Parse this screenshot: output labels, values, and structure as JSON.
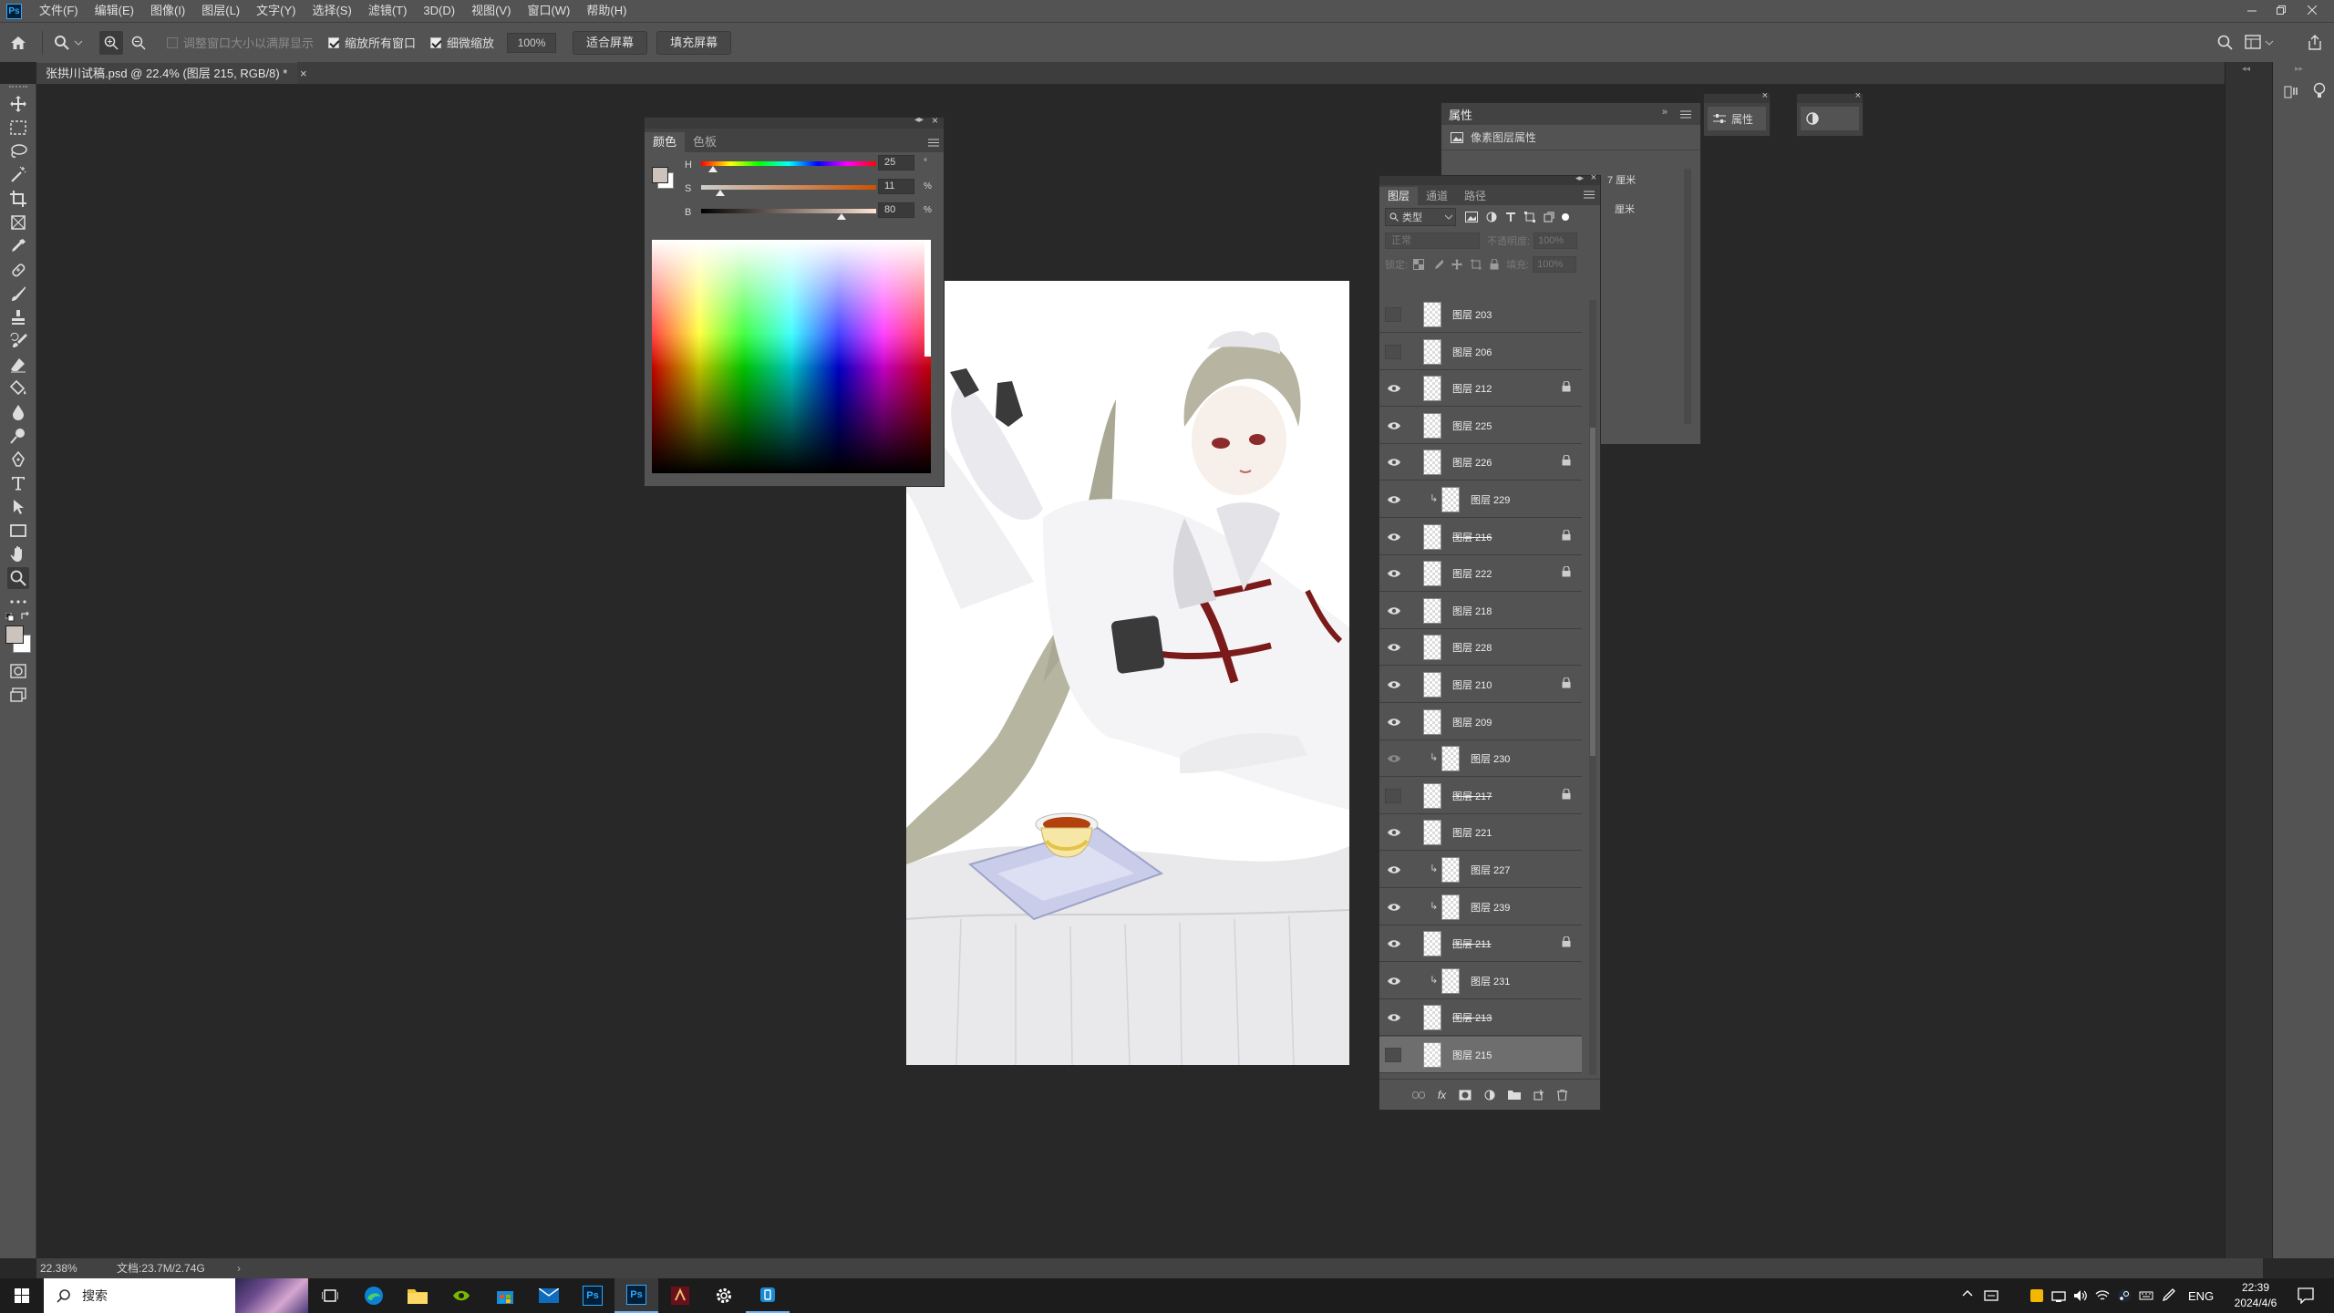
{
  "app": {
    "logo": "Ps"
  },
  "menu": [
    "文件(F)",
    "编辑(E)",
    "图像(I)",
    "图层(L)",
    "文字(Y)",
    "选择(S)",
    "滤镜(T)",
    "3D(D)",
    "视图(V)",
    "窗口(W)",
    "帮助(H)"
  ],
  "options": {
    "resize_windows_label": "调整窗口大小以满屏显示",
    "zoom_all_label": "缩放所有窗口",
    "scrubby_zoom_label": "细微缩放",
    "zoom_value": "100%",
    "fit_screen": "适合屏幕",
    "fill_screen": "填充屏幕",
    "resize_windows_checked": false,
    "zoom_all_checked": true,
    "scrubby_zoom_checked": true
  },
  "document_tab": {
    "title": "张拱川试稿.psd @ 22.4% (图层 215, RGB/8) *"
  },
  "color_panel": {
    "tabs": [
      "颜色",
      "色板"
    ],
    "active_tab": "颜色",
    "h_label": "H",
    "h_value": "25",
    "h_unit": "°",
    "s_label": "S",
    "s_value": "11",
    "s_unit": "%",
    "b_label": "B",
    "b_value": "80",
    "b_unit": "%",
    "h_fraction": 0.07,
    "s_fraction": 0.11,
    "b_fraction": 0.8,
    "foreground": "#ccc3bd",
    "background": "#ffffff"
  },
  "properties_panel": {
    "title": "属性",
    "subtitle": "像素图层属性",
    "w_label": "7 厘米",
    "h_label": "厘米"
  },
  "properties_mini": {
    "label": "属性"
  },
  "layers_panel": {
    "tabs": [
      "图层",
      "通道",
      "路径"
    ],
    "active_tab": "图层",
    "filter_label": "类型",
    "blend_mode": "正常",
    "opacity_label": "不透明度:",
    "opacity_value": "100%",
    "lock_label": "锁定:",
    "fill_label": "填充:",
    "fill_value": "100%",
    "layers": [
      {
        "name": "图层 203",
        "visible": false,
        "locked": false,
        "clip": false,
        "strike": false,
        "selected": false
      },
      {
        "name": "图层 206",
        "visible": false,
        "locked": false,
        "clip": false,
        "strike": false,
        "selected": false
      },
      {
        "name": "图层 212",
        "visible": true,
        "locked": true,
        "clip": false,
        "strike": false,
        "selected": false
      },
      {
        "name": "图层 225",
        "visible": true,
        "locked": false,
        "clip": false,
        "strike": false,
        "selected": false
      },
      {
        "name": "图层 226",
        "visible": true,
        "locked": true,
        "clip": false,
        "strike": false,
        "selected": false
      },
      {
        "name": "图层 229",
        "visible": true,
        "locked": false,
        "clip": true,
        "strike": false,
        "selected": false
      },
      {
        "name": "图层 216",
        "visible": true,
        "locked": true,
        "clip": false,
        "strike": true,
        "selected": false
      },
      {
        "name": "图层 222",
        "visible": true,
        "locked": true,
        "clip": false,
        "strike": false,
        "selected": false
      },
      {
        "name": "图层 218",
        "visible": true,
        "locked": false,
        "clip": false,
        "strike": false,
        "selected": false
      },
      {
        "name": "图层 228",
        "visible": true,
        "locked": false,
        "clip": false,
        "strike": false,
        "selected": false
      },
      {
        "name": "图层 210",
        "visible": true,
        "locked": true,
        "clip": false,
        "strike": false,
        "selected": false
      },
      {
        "name": "图层 209",
        "visible": true,
        "locked": false,
        "clip": false,
        "strike": false,
        "selected": false
      },
      {
        "name": "图层 230",
        "visible": "dim",
        "locked": false,
        "clip": true,
        "strike": false,
        "selected": false
      },
      {
        "name": "图层 217",
        "visible": false,
        "locked": true,
        "clip": false,
        "strike": true,
        "selected": false
      },
      {
        "name": "图层 221",
        "visible": true,
        "locked": false,
        "clip": false,
        "strike": false,
        "selected": false
      },
      {
        "name": "图层 227",
        "visible": true,
        "locked": false,
        "clip": true,
        "strike": false,
        "selected": false
      },
      {
        "name": "图层 239",
        "visible": true,
        "locked": false,
        "clip": true,
        "strike": false,
        "selected": false
      },
      {
        "name": "图层 211",
        "visible": true,
        "locked": true,
        "clip": false,
        "strike": true,
        "selected": false
      },
      {
        "name": "图层 231",
        "visible": true,
        "locked": false,
        "clip": true,
        "strike": false,
        "selected": false
      },
      {
        "name": "图层 213",
        "visible": true,
        "locked": false,
        "clip": false,
        "strike": true,
        "selected": false
      },
      {
        "name": "图层 215",
        "visible": false,
        "locked": false,
        "clip": false,
        "strike": false,
        "selected": true
      }
    ]
  },
  "status": {
    "zoom": "22.38%",
    "doc_info": "文档:23.7M/2.74G"
  },
  "taskbar": {
    "search_placeholder": "搜索",
    "lang": "ENG",
    "time": "22:39",
    "date": "2024/4/6"
  }
}
